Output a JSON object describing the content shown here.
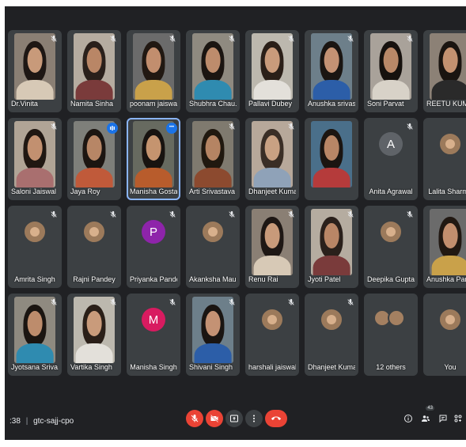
{
  "meeting": {
    "time": ":38",
    "separator": "|",
    "code": "gtc-sajj-cpo"
  },
  "colors": {
    "background": "#202124",
    "tile": "#3c4043",
    "accent_red": "#ea4335",
    "speaking_blue": "#1a73e8"
  },
  "participants": [
    {
      "name": "Dr.Vinita",
      "type": "video",
      "mic": "muted"
    },
    {
      "name": "Namita Sinha",
      "type": "video",
      "mic": "muted"
    },
    {
      "name": "poonam jaiswa...",
      "type": "video",
      "mic": "muted"
    },
    {
      "name": "Shubhra Chau...",
      "type": "video",
      "mic": "muted"
    },
    {
      "name": "Pallavi Dubey",
      "type": "video",
      "mic": "muted"
    },
    {
      "name": "Anushka srivas...",
      "type": "video",
      "mic": "muted"
    },
    {
      "name": "Soni Parvat",
      "type": "video",
      "mic": "muted"
    },
    {
      "name": "REETU KUMARI",
      "type": "video",
      "mic": "muted"
    },
    {
      "name": "Saloni Jaiswal",
      "type": "video",
      "mic": "muted"
    },
    {
      "name": "Jaya Roy",
      "type": "video",
      "mic": "speaking"
    },
    {
      "name": "Manisha Gosta",
      "type": "video",
      "mic": "more",
      "active": true
    },
    {
      "name": "Arti Srivastava",
      "type": "video",
      "mic": "muted"
    },
    {
      "name": "Dhanjeet Kumar",
      "type": "video",
      "mic": "muted"
    },
    {
      "name": "",
      "type": "video",
      "mic": "none"
    },
    {
      "name": "Anita Agrawal",
      "type": "letter",
      "letter": "A",
      "avatar_color": "#5f6368",
      "mic": "muted"
    },
    {
      "name": "Lalita Sharma",
      "type": "photo-avatar",
      "mic": "muted"
    },
    {
      "name": "Amrita Singh",
      "type": "photo-avatar",
      "mic": "muted"
    },
    {
      "name": "Rajni Pandey",
      "type": "photo-avatar",
      "mic": "muted"
    },
    {
      "name": "Priyanka Pandey",
      "type": "letter",
      "letter": "P",
      "avatar_color": "#8e24aa",
      "mic": "muted"
    },
    {
      "name": "Akanksha Maur...",
      "type": "photo-avatar",
      "mic": "muted"
    },
    {
      "name": "Renu Rai",
      "type": "video",
      "mic": "muted"
    },
    {
      "name": "Jyoti Patel",
      "type": "video",
      "mic": "muted"
    },
    {
      "name": "Deepika Gupta",
      "type": "photo-avatar",
      "mic": "muted"
    },
    {
      "name": "Anushka Pand...",
      "type": "video",
      "mic": "muted"
    },
    {
      "name": "Jyotsana Sriva...",
      "type": "video",
      "mic": "muted"
    },
    {
      "name": "Vartika Singh",
      "type": "video",
      "mic": "muted"
    },
    {
      "name": "Manisha Singh",
      "type": "letter",
      "letter": "M",
      "avatar_color": "#d81b60",
      "mic": "muted"
    },
    {
      "name": "Shivani Singh",
      "type": "video",
      "mic": "muted"
    },
    {
      "name": "harshali jaiswal",
      "type": "photo-avatar",
      "mic": "muted"
    },
    {
      "name": "Dhanjeet Kumar",
      "type": "photo-avatar",
      "mic": "muted"
    },
    {
      "name": "12 others",
      "type": "group",
      "mic": "none"
    },
    {
      "name": "You",
      "type": "photo-avatar",
      "mic": "muted"
    }
  ],
  "controls": {
    "mic_button": "mic-off-icon",
    "camera_button": "camera-off-icon",
    "present_button": "present-icon",
    "more_button": "more-vert-icon",
    "leave_button": "call-end-icon"
  },
  "right_controls": {
    "info": "info-icon",
    "people": "people-icon",
    "people_count": "43",
    "chat": "chat-icon",
    "activities": "activities-icon"
  }
}
